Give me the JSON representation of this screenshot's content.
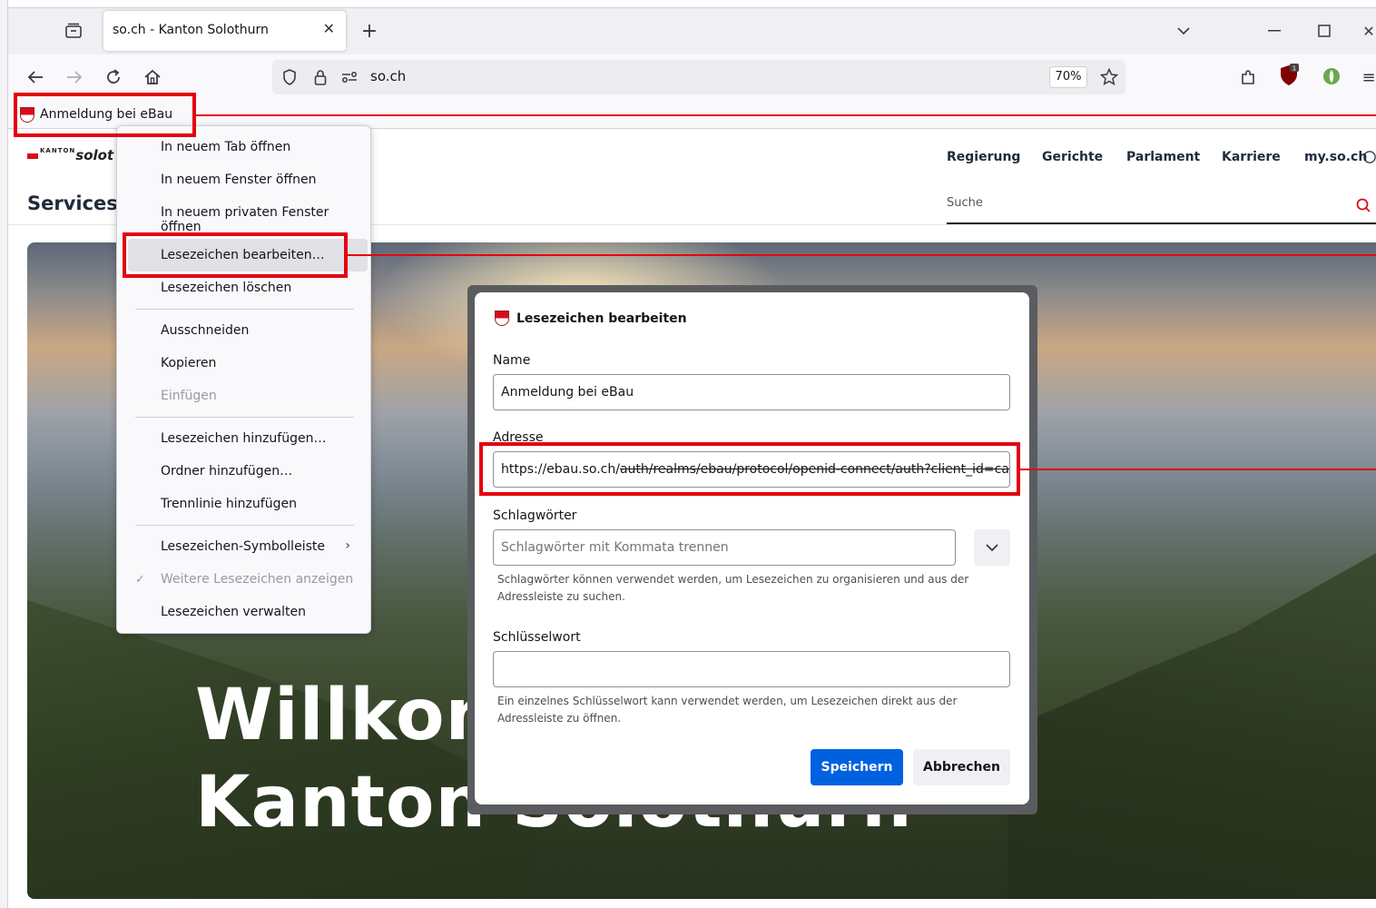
{
  "browser": {
    "tab_title": "so.ch - Kanton Solothurn",
    "url": "so.ch",
    "zoom": "70%",
    "colors": {
      "accent": "#0061e0",
      "highlight_red": "#e3000f"
    }
  },
  "bookmarks_bar": {
    "item_label": "Anmeldung bei eBau"
  },
  "page": {
    "logo_prefix": "KANTON",
    "logo_text": "solot",
    "section_title": "Services",
    "nav": [
      "Regierung",
      "Gerichte",
      "Parlament",
      "Karriere",
      "my.so.ch"
    ],
    "search_placeholder": "Suche",
    "hero_line1": "Willkom",
    "hero_line2": "Kanton Solothurn"
  },
  "context_menu": {
    "items": [
      "In neuem Tab öffnen",
      "In neuem Fenster öffnen",
      "In neuem privaten Fenster öffnen",
      "Lesezeichen bearbeiten…",
      "Lesezeichen löschen",
      "Ausschneiden",
      "Kopieren",
      "Einfügen",
      "Lesezeichen hinzufügen…",
      "Ordner hinzufügen…",
      "Trennlinie hinzufügen",
      "Lesezeichen-Symbolleiste",
      "Weitere Lesezeichen anzeigen",
      "Lesezeichen verwalten"
    ],
    "highlighted_index": 3,
    "disabled": [
      "Einfügen",
      "Weitere Lesezeichen anzeigen"
    ]
  },
  "dialog": {
    "title": "Lesezeichen bearbeiten",
    "name_label": "Name",
    "name_value": "Anmeldung bei eBau",
    "address_label": "Adresse",
    "address_value_start": "https://ebau.so.ch/",
    "address_value_rest": "auth/realms/ebau/protocol/openid-connect/auth?client_id=can",
    "tags_label": "Schlagwörter",
    "tags_placeholder": "Schlagwörter mit Kommata trennen",
    "tags_help": "Schlagwörter können verwendet werden, um Lesezeichen zu organisieren und aus der Adressleiste zu suchen.",
    "keyword_label": "Schlüsselwort",
    "keyword_value": "",
    "keyword_help": "Ein einzelnes Schlüsselwort kann verwendet werden, um Lesezeichen direkt aus der Adressleiste zu öffnen.",
    "save_label": "Speichern",
    "cancel_label": "Abbrechen"
  }
}
